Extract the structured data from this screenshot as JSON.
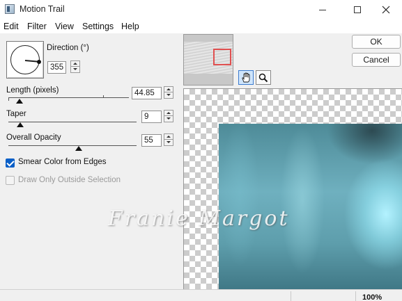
{
  "window": {
    "title": "Motion Trail"
  },
  "menu": [
    "Edit",
    "Filter",
    "View",
    "Settings",
    "Help"
  ],
  "direction": {
    "label": "Direction (°)",
    "value": "355"
  },
  "length": {
    "label": "Length (pixels)",
    "value": "44.85",
    "slider_fraction": 0.09
  },
  "taper": {
    "label": "Taper",
    "value": "9",
    "slider_fraction": 0.09
  },
  "opacity": {
    "label": "Overall Opacity",
    "value": "55",
    "slider_fraction": 0.55
  },
  "smear": {
    "label": "Smear Color from Edges",
    "checked": true
  },
  "draw_only": {
    "label": "Draw Only Outside Selection",
    "checked": false,
    "disabled": true
  },
  "buttons": {
    "ok": "OK",
    "cancel": "Cancel"
  },
  "watermark": "Franie Margot",
  "status": {
    "zoom": "100%"
  },
  "icons": [
    "motion-trail-app-icon",
    "minimize-icon",
    "maximize-icon",
    "close-icon",
    "hand-pan-icon",
    "zoom-magnifier-icon"
  ]
}
